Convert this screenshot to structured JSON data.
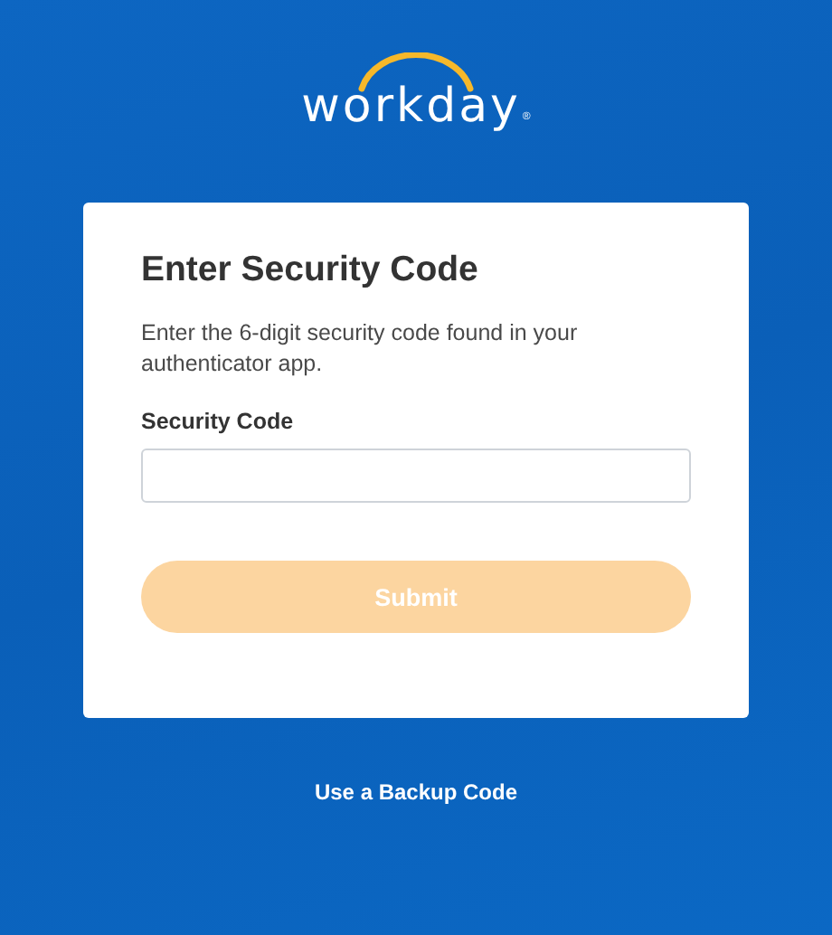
{
  "logo": {
    "wordmark": "workday",
    "mark": "®"
  },
  "card": {
    "title": "Enter Security Code",
    "description": "Enter the 6-digit security code found in your authenticator app.",
    "field": {
      "label": "Security Code"
    },
    "submit": {
      "label": "Submit",
      "disabled": true
    }
  },
  "backup_link": "Use a Backup Code"
}
